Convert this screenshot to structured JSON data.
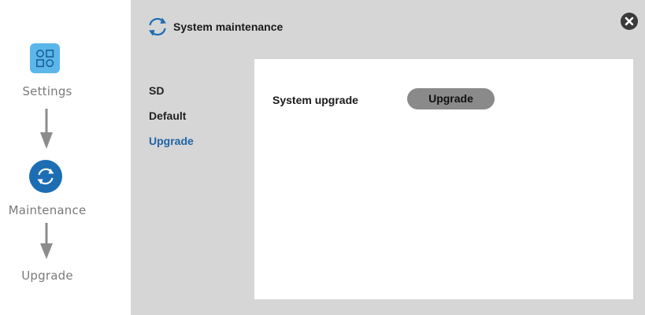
{
  "guide": {
    "steps": [
      {
        "label": "Settings",
        "icon": "settings-grid-icon"
      },
      {
        "label": "Maintenance",
        "icon": "refresh-icon"
      },
      {
        "label": "Upgrade"
      }
    ],
    "arrow_icon": "arrow-down-icon"
  },
  "dialog": {
    "title": "System maintenance",
    "title_icon": "refresh-icon",
    "close_icon": "close-icon",
    "nav": [
      {
        "label": "SD",
        "active": false
      },
      {
        "label": "Default",
        "active": false
      },
      {
        "label": "Upgrade",
        "active": true
      }
    ],
    "content": {
      "row_label": "System upgrade",
      "button_label": "Upgrade"
    }
  },
  "colors": {
    "accent": "#1c6db3",
    "settings_icon_bg": "#5bb6ea",
    "dialog_bg": "#d6d6d6",
    "active_nav": "#1f63a8",
    "button_bg": "#8a8a8a"
  }
}
